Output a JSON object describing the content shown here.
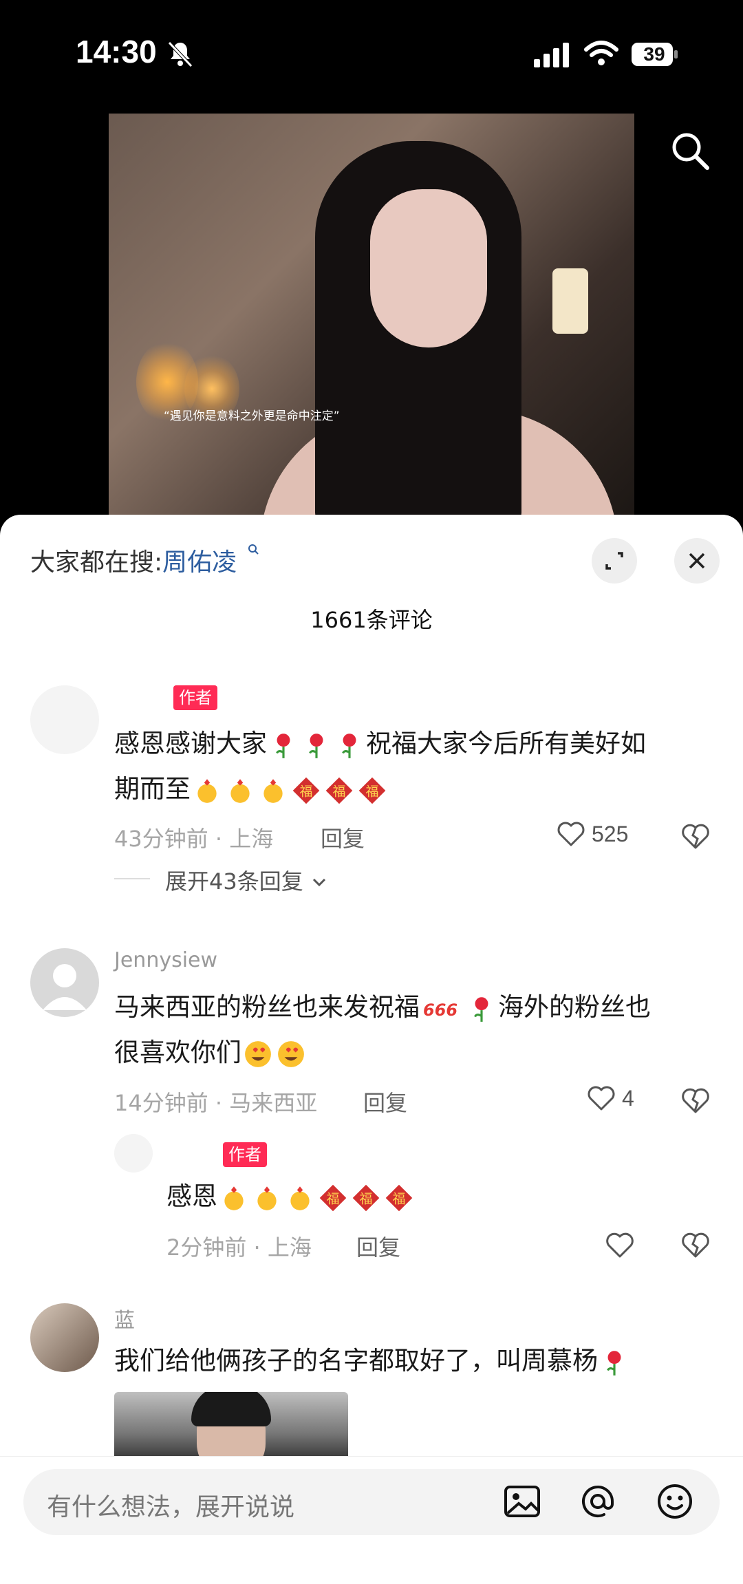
{
  "status_bar": {
    "time": "14:30",
    "battery": "39"
  },
  "video": {
    "subtitle": "“遇见你是意料之外更是命中注定”"
  },
  "comments_panel": {
    "hot_search_label": "大家都在搜:",
    "hot_search_keyword": "周佑凌",
    "comment_count": "1661条评论"
  },
  "comments": [
    {
      "badge": "作者",
      "line1": "感恩感谢大家",
      "line1b": "祝福大家今后所有美好如",
      "line2": "期而至",
      "time_location": "43分钟前 · 上海",
      "reply_label": "回复",
      "likes": "525",
      "expand_replies": "展开43条回复"
    },
    {
      "username": "Jennysiew",
      "line1": "马来西亚的粉丝也来发祝福",
      "line1b": "海外的粉丝也",
      "line2": "很喜欢你们",
      "time_location": "14分钟前 · 马来西亚",
      "reply_label": "回复",
      "likes": "4",
      "reply": {
        "badge": "作者",
        "text": "感恩",
        "time_location": "2分钟前 · 上海",
        "reply_label": "回复"
      }
    },
    {
      "username": "蓝",
      "text": "我们给他俩孩子的名字都取好了，叫周慕杨"
    }
  ],
  "input_bar": {
    "placeholder": "有什么想法，展开说说"
  },
  "icons": {
    "rose": "rose-icon",
    "heart_hands": "finger-heart-icon",
    "fu": "fu-icon",
    "heart_eyes": "heart-eyes-icon",
    "666": "666-icon"
  },
  "colors": {
    "badge": "#ff2b55",
    "keyword": "#2d5d9f"
  }
}
